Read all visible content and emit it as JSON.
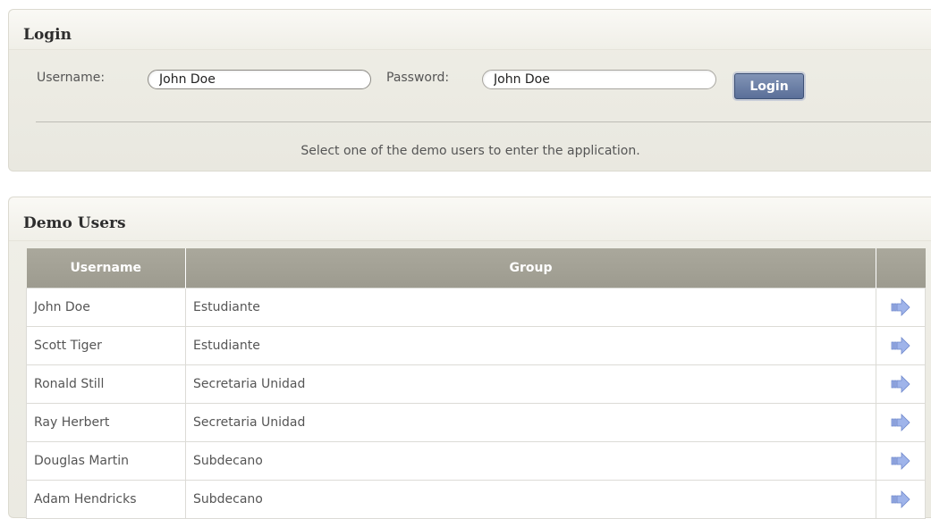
{
  "login": {
    "title": "Login",
    "username_label": "Username:",
    "username_value": "John Doe",
    "password_label": "Password:",
    "password_value": "John Doe",
    "login_button": "Login",
    "hint": "Select one of the demo users to enter the application."
  },
  "demo_users": {
    "title": "Demo Users",
    "columns": [
      "Username",
      "Group",
      ""
    ],
    "rows": [
      {
        "username": "John Doe",
        "group": "Estudiante",
        "action_icon": "arrow-right-icon"
      },
      {
        "username": "Scott Tiger",
        "group": "Estudiante",
        "action_icon": "arrow-right-icon"
      },
      {
        "username": "Ronald Still",
        "group": "Secretaria Unidad",
        "action_icon": "arrow-right-icon"
      },
      {
        "username": "Ray Herbert",
        "group": "Secretaria Unidad",
        "action_icon": "arrow-right-icon"
      },
      {
        "username": "Douglas Martin",
        "group": "Subdecano",
        "action_icon": "arrow-right-icon"
      },
      {
        "username": "Adam Hendricks",
        "group": "Subdecano",
        "action_icon": "arrow-right-icon"
      }
    ]
  },
  "colors": {
    "header_bg": "#a39f93",
    "button_bg": "#6b7fa6",
    "arrow": "#8fa6e0"
  }
}
